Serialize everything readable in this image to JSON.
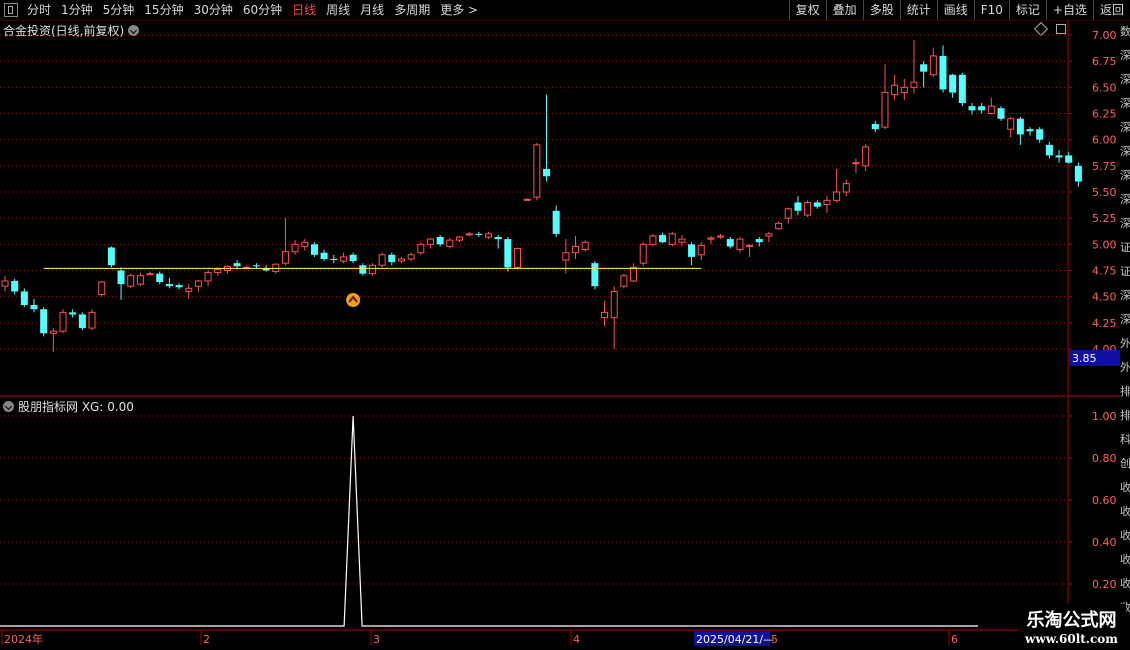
{
  "toolbar": {
    "periods": [
      "分时",
      "1分钟",
      "5分钟",
      "15分钟",
      "30分钟",
      "60分钟",
      "日线",
      "周线",
      "月线",
      "多周期",
      "更多 >"
    ],
    "active_period": "日线",
    "right_buttons": [
      "复权",
      "叠加",
      "多股",
      "统计",
      "画线",
      "F10",
      "标记",
      "+自选",
      "返回"
    ]
  },
  "main_chart": {
    "title": "合金投资(日线,前复权)",
    "price_axis_labels": [
      "7.00",
      "6.75",
      "6.50",
      "6.25",
      "6.00",
      "5.75",
      "5.50",
      "5.25",
      "5.00",
      "4.75",
      "4.50",
      "4.25",
      "4.00"
    ],
    "current_price_box": "3.85",
    "support_line_price": 4.77
  },
  "indicator": {
    "title": "股朋指标网  XG: 0.00",
    "axis_labels": [
      "1.00",
      "0.80",
      "0.60",
      "0.40",
      "0.20"
    ]
  },
  "date_axis": {
    "labels": [
      "2024年",
      "2",
      "3",
      "4",
      "5",
      "6"
    ],
    "cursor_date": "2025/04/21/—"
  },
  "sidebar_chars": [
    "数",
    "深",
    "深",
    "深",
    "深",
    "深",
    "深",
    "深",
    "深",
    "证",
    "证",
    "深",
    "深",
    "外",
    "外",
    "排",
    "排",
    "科",
    "创",
    "收",
    "收",
    "收",
    "收",
    "收",
    "收"
  ],
  "watermark": {
    "title": "乐淘公式网",
    "url": "www.60lt.com"
  },
  "colors": {
    "up": "#ff5050",
    "down": "#54ffff",
    "support_line": "#ffff55",
    "grid": "#8a1a1a",
    "axis_text": "#ff6060"
  },
  "chart_data": {
    "type": "candlestick",
    "title": "合金投资(日线,前复权)",
    "ylim": [
      4.0,
      7.05
    ],
    "x": [
      "2024年",
      "2",
      "3",
      "4",
      "5",
      "6"
    ],
    "candles": [
      {
        "o": 4.6,
        "h": 4.7,
        "l": 4.55,
        "c": 4.65
      },
      {
        "o": 4.65,
        "h": 4.67,
        "l": 4.52,
        "c": 4.55
      },
      {
        "o": 4.55,
        "h": 4.58,
        "l": 4.4,
        "c": 4.42
      },
      {
        "o": 4.42,
        "h": 4.48,
        "l": 4.35,
        "c": 4.38
      },
      {
        "o": 4.38,
        "h": 4.4,
        "l": 4.12,
        "c": 4.15
      },
      {
        "o": 4.15,
        "h": 4.2,
        "l": 3.97,
        "c": 4.17
      },
      {
        "o": 4.17,
        "h": 4.38,
        "l": 4.15,
        "c": 4.35
      },
      {
        "o": 4.35,
        "h": 4.38,
        "l": 4.3,
        "c": 4.33
      },
      {
        "o": 4.33,
        "h": 4.35,
        "l": 4.18,
        "c": 4.2
      },
      {
        "o": 4.2,
        "h": 4.38,
        "l": 4.18,
        "c": 4.35
      },
      {
        "o": 4.52,
        "h": 4.65,
        "l": 4.5,
        "c": 4.64
      },
      {
        "o": 4.97,
        "h": 4.98,
        "l": 4.78,
        "c": 4.8
      },
      {
        "o": 4.75,
        "h": 4.78,
        "l": 4.47,
        "c": 4.62
      },
      {
        "o": 4.6,
        "h": 4.72,
        "l": 4.58,
        "c": 4.7
      },
      {
        "o": 4.62,
        "h": 4.73,
        "l": 4.6,
        "c": 4.7
      },
      {
        "o": 4.72,
        "h": 4.74,
        "l": 4.71,
        "c": 4.72
      },
      {
        "o": 4.72,
        "h": 4.74,
        "l": 4.62,
        "c": 4.64
      },
      {
        "o": 4.62,
        "h": 4.68,
        "l": 4.58,
        "c": 4.6
      },
      {
        "o": 4.61,
        "h": 4.63,
        "l": 4.57,
        "c": 4.59
      },
      {
        "o": 4.55,
        "h": 4.62,
        "l": 4.48,
        "c": 4.58
      },
      {
        "o": 4.6,
        "h": 4.66,
        "l": 4.55,
        "c": 4.65
      },
      {
        "o": 4.65,
        "h": 4.75,
        "l": 4.6,
        "c": 4.73
      },
      {
        "o": 4.73,
        "h": 4.78,
        "l": 4.7,
        "c": 4.76
      },
      {
        "o": 4.75,
        "h": 4.8,
        "l": 4.72,
        "c": 4.79
      },
      {
        "o": 4.82,
        "h": 4.85,
        "l": 4.76,
        "c": 4.79
      },
      {
        "o": 4.78,
        "h": 4.8,
        "l": 4.76,
        "c": 4.78
      },
      {
        "o": 4.8,
        "h": 4.82,
        "l": 4.77,
        "c": 4.79
      },
      {
        "o": 4.77,
        "h": 4.8,
        "l": 4.74,
        "c": 4.75
      },
      {
        "o": 4.74,
        "h": 4.82,
        "l": 4.72,
        "c": 4.81
      },
      {
        "o": 4.82,
        "h": 5.25,
        "l": 4.8,
        "c": 4.93
      },
      {
        "o": 4.93,
        "h": 5.04,
        "l": 4.9,
        "c": 5.0
      },
      {
        "o": 4.98,
        "h": 5.05,
        "l": 4.94,
        "c": 5.02
      },
      {
        "o": 5.0,
        "h": 5.02,
        "l": 4.88,
        "c": 4.9
      },
      {
        "o": 4.92,
        "h": 4.95,
        "l": 4.84,
        "c": 4.86
      },
      {
        "o": 4.86,
        "h": 4.9,
        "l": 4.82,
        "c": 4.85
      },
      {
        "o": 4.84,
        "h": 4.92,
        "l": 4.82,
        "c": 4.88
      },
      {
        "o": 4.9,
        "h": 4.92,
        "l": 4.82,
        "c": 4.84
      },
      {
        "o": 4.8,
        "h": 4.82,
        "l": 4.7,
        "c": 4.72
      },
      {
        "o": 4.72,
        "h": 4.82,
        "l": 4.7,
        "c": 4.8
      },
      {
        "o": 4.8,
        "h": 4.92,
        "l": 4.78,
        "c": 4.9
      },
      {
        "o": 4.9,
        "h": 4.92,
        "l": 4.8,
        "c": 4.83
      },
      {
        "o": 4.84,
        "h": 4.88,
        "l": 4.82,
        "c": 4.86
      },
      {
        "o": 4.86,
        "h": 4.92,
        "l": 4.84,
        "c": 4.9
      },
      {
        "o": 4.92,
        "h": 5.02,
        "l": 4.9,
        "c": 5.0
      },
      {
        "o": 5.0,
        "h": 5.06,
        "l": 4.96,
        "c": 5.05
      },
      {
        "o": 5.07,
        "h": 5.09,
        "l": 4.98,
        "c": 5.0
      },
      {
        "o": 4.98,
        "h": 5.06,
        "l": 4.96,
        "c": 5.04
      },
      {
        "o": 5.04,
        "h": 5.08,
        "l": 5.02,
        "c": 5.07
      },
      {
        "o": 5.09,
        "h": 5.12,
        "l": 5.08,
        "c": 5.1
      },
      {
        "o": 5.1,
        "h": 5.12,
        "l": 5.07,
        "c": 5.09
      },
      {
        "o": 5.07,
        "h": 5.12,
        "l": 5.05,
        "c": 5.1
      },
      {
        "o": 5.07,
        "h": 5.09,
        "l": 4.96,
        "c": 5.05
      },
      {
        "o": 5.05,
        "h": 5.07,
        "l": 4.74,
        "c": 4.78
      },
      {
        "o": 4.78,
        "h": 4.97,
        "l": 4.76,
        "c": 4.96
      },
      {
        "o": 5.43,
        "h": 5.44,
        "l": 5.42,
        "c": 5.43
      },
      {
        "o": 5.45,
        "h": 5.97,
        "l": 5.42,
        "c": 5.95
      },
      {
        "o": 5.72,
        "h": 6.43,
        "l": 5.6,
        "c": 5.65
      },
      {
        "o": 5.32,
        "h": 5.37,
        "l": 5.07,
        "c": 5.1
      },
      {
        "o": 4.85,
        "h": 5.05,
        "l": 4.72,
        "c": 4.92
      },
      {
        "o": 4.92,
        "h": 5.08,
        "l": 4.86,
        "c": 4.98
      },
      {
        "o": 4.95,
        "h": 5.04,
        "l": 4.93,
        "c": 5.02
      },
      {
        "o": 4.82,
        "h": 4.84,
        "l": 4.57,
        "c": 4.6
      },
      {
        "o": 4.3,
        "h": 4.46,
        "l": 4.22,
        "c": 4.35
      },
      {
        "o": 4.3,
        "h": 4.6,
        "l": 4.0,
        "c": 4.55
      },
      {
        "o": 4.6,
        "h": 4.72,
        "l": 4.58,
        "c": 4.7
      },
      {
        "o": 4.65,
        "h": 4.82,
        "l": 4.64,
        "c": 4.78
      },
      {
        "o": 4.82,
        "h": 5.02,
        "l": 4.79,
        "c": 5.0
      },
      {
        "o": 5.0,
        "h": 5.1,
        "l": 4.98,
        "c": 5.08
      },
      {
        "o": 5.09,
        "h": 5.11,
        "l": 5.01,
        "c": 5.02
      },
      {
        "o": 5.0,
        "h": 5.12,
        "l": 4.98,
        "c": 5.1
      },
      {
        "o": 5.02,
        "h": 5.09,
        "l": 4.98,
        "c": 5.05
      },
      {
        "o": 5.0,
        "h": 5.02,
        "l": 4.8,
        "c": 4.88
      },
      {
        "o": 4.9,
        "h": 5.02,
        "l": 4.85,
        "c": 4.99
      },
      {
        "o": 5.05,
        "h": 5.08,
        "l": 5.0,
        "c": 5.06
      },
      {
        "o": 5.07,
        "h": 5.1,
        "l": 5.05,
        "c": 5.08
      },
      {
        "o": 5.05,
        "h": 5.07,
        "l": 4.96,
        "c": 4.98
      },
      {
        "o": 4.95,
        "h": 5.07,
        "l": 4.92,
        "c": 5.05
      },
      {
        "o": 4.98,
        "h": 5.0,
        "l": 4.88,
        "c": 4.99
      },
      {
        "o": 5.05,
        "h": 5.07,
        "l": 4.98,
        "c": 5.02
      },
      {
        "o": 5.08,
        "h": 5.12,
        "l": 5.02,
        "c": 5.1
      },
      {
        "o": 5.15,
        "h": 5.22,
        "l": 5.14,
        "c": 5.2
      },
      {
        "o": 5.25,
        "h": 5.35,
        "l": 5.2,
        "c": 5.34
      },
      {
        "o": 5.4,
        "h": 5.46,
        "l": 5.28,
        "c": 5.32
      },
      {
        "o": 5.28,
        "h": 5.42,
        "l": 5.26,
        "c": 5.4
      },
      {
        "o": 5.4,
        "h": 5.42,
        "l": 5.34,
        "c": 5.36
      },
      {
        "o": 5.38,
        "h": 5.46,
        "l": 5.3,
        "c": 5.42
      },
      {
        "o": 5.42,
        "h": 5.72,
        "l": 5.4,
        "c": 5.5
      },
      {
        "o": 5.5,
        "h": 5.62,
        "l": 5.46,
        "c": 5.58
      },
      {
        "o": 5.78,
        "h": 5.82,
        "l": 5.68,
        "c": 5.78
      },
      {
        "o": 5.75,
        "h": 5.96,
        "l": 5.7,
        "c": 5.93
      },
      {
        "o": 6.15,
        "h": 6.18,
        "l": 6.07,
        "c": 6.1
      },
      {
        "o": 6.12,
        "h": 6.72,
        "l": 6.1,
        "c": 6.45
      },
      {
        "o": 6.43,
        "h": 6.62,
        "l": 6.38,
        "c": 6.52
      },
      {
        "o": 6.45,
        "h": 6.58,
        "l": 6.38,
        "c": 6.5
      },
      {
        "o": 6.5,
        "h": 6.95,
        "l": 6.44,
        "c": 6.55
      },
      {
        "o": 6.72,
        "h": 6.75,
        "l": 6.5,
        "c": 6.65
      },
      {
        "o": 6.62,
        "h": 6.88,
        "l": 6.6,
        "c": 6.8
      },
      {
        "o": 6.8,
        "h": 6.9,
        "l": 6.45,
        "c": 6.48
      },
      {
        "o": 6.62,
        "h": 6.63,
        "l": 6.4,
        "c": 6.45
      },
      {
        "o": 6.62,
        "h": 6.64,
        "l": 6.32,
        "c": 6.35
      },
      {
        "o": 6.32,
        "h": 6.35,
        "l": 6.24,
        "c": 6.28
      },
      {
        "o": 6.32,
        "h": 6.35,
        "l": 6.25,
        "c": 6.28
      },
      {
        "o": 6.25,
        "h": 6.4,
        "l": 6.24,
        "c": 6.32
      },
      {
        "o": 6.3,
        "h": 6.32,
        "l": 6.18,
        "c": 6.2
      },
      {
        "o": 6.1,
        "h": 6.22,
        "l": 6.02,
        "c": 6.2
      },
      {
        "o": 6.2,
        "h": 6.22,
        "l": 5.95,
        "c": 6.05
      },
      {
        "o": 6.1,
        "h": 6.12,
        "l": 6.04,
        "c": 6.08
      },
      {
        "o": 6.1,
        "h": 6.12,
        "l": 5.97,
        "c": 6.0
      },
      {
        "o": 5.95,
        "h": 5.98,
        "l": 5.82,
        "c": 5.85
      },
      {
        "o": 5.85,
        "h": 5.9,
        "l": 5.78,
        "c": 5.83
      },
      {
        "o": 5.85,
        "h": 5.88,
        "l": 5.77,
        "c": 5.78
      },
      {
        "o": 5.75,
        "h": 5.78,
        "l": 5.55,
        "c": 5.6
      }
    ],
    "support_line": {
      "price": 4.77,
      "from_index": 4,
      "to_index": 72
    },
    "indicator": {
      "name": "XG",
      "ylim": [
        0,
        1.05
      ],
      "signal_index": 36,
      "signal_value": 1.0
    }
  }
}
